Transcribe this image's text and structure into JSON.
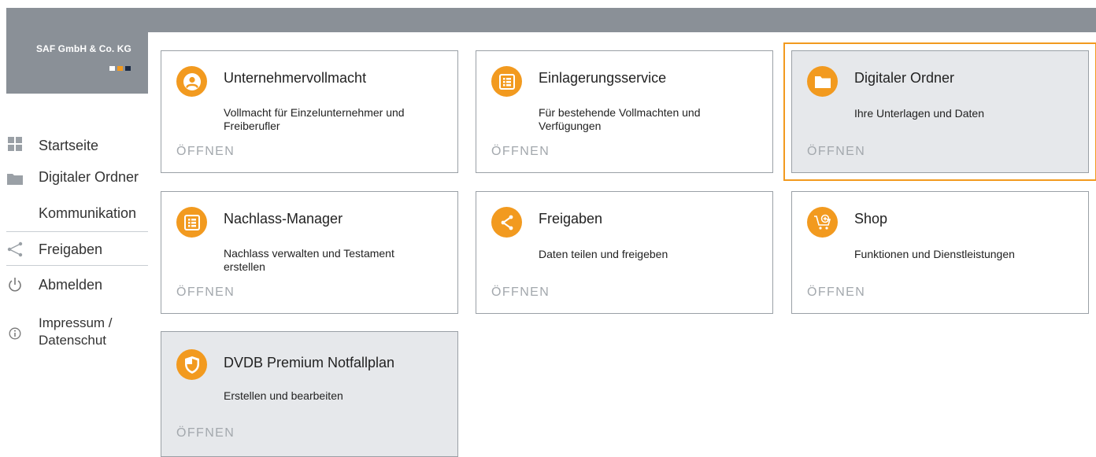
{
  "company": {
    "name": "SAF GmbH & Co. KG",
    "square_colors": [
      "#ffffff",
      "#f29a1f",
      "#1b2a44"
    ]
  },
  "colors": {
    "accent": "#f29a1f",
    "header": "#8a9097"
  },
  "sidebar": {
    "items": [
      {
        "label": "Startseite",
        "icon": "grid-icon"
      },
      {
        "label": "Digitaler Ordner",
        "icon": "folder-icon"
      },
      {
        "label": "Kommunikation",
        "icon": ""
      },
      {
        "label": "Freigaben",
        "icon": "share-icon"
      },
      {
        "label": "Abmelden",
        "icon": "power-icon"
      },
      {
        "label_line1": "Impressum /",
        "label_line2": "Datenschut",
        "icon": "info-icon"
      }
    ]
  },
  "cards": [
    {
      "title": "Unternehmervollmacht",
      "desc": "Vollmacht für Einzelunternehmer und Freiberufler",
      "action": "ÖFFNEN",
      "icon": "person-icon"
    },
    {
      "title": "Einlagerungsservice",
      "desc": "Für bestehende Vollmachten und Verfügungen",
      "action": "ÖFFNEN",
      "icon": "list-icon"
    },
    {
      "title": "Digitaler Ordner",
      "desc": "Ihre Unterlagen und Daten",
      "action": "ÖFFNEN",
      "icon": "folder-icon",
      "selected": true
    },
    {
      "title": "Nachlass-Manager",
      "desc": "Nachlass verwalten und Testament erstellen",
      "action": "ÖFFNEN",
      "icon": "list-icon"
    },
    {
      "title": "Freigaben",
      "desc": "Daten teilen und freigeben",
      "action": "ÖFFNEN",
      "icon": "share-icon"
    },
    {
      "title": "Shop",
      "desc": "Funktionen und Dienstleistungen",
      "action": "ÖFFNEN",
      "icon": "cart-icon"
    },
    {
      "title": "DVDB Premium Notfallplan",
      "desc": "Erstellen und bearbeiten",
      "action": "ÖFFNEN",
      "icon": "shield-icon"
    }
  ]
}
